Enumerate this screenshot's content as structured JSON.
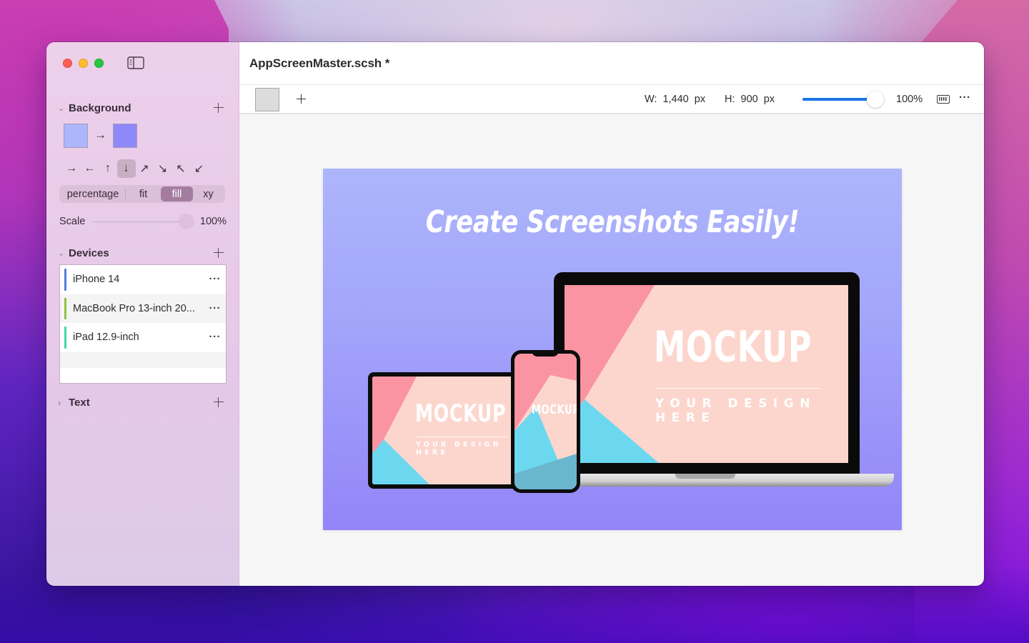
{
  "window": {
    "document_title": "AppScreenMaster.scsh *"
  },
  "sidebar": {
    "background_section": {
      "title": "Background",
      "gradient_from": "#aeb6fb",
      "gradient_to": "#8e88f8",
      "directions": [
        {
          "name": "right",
          "glyph": "→",
          "active": false
        },
        {
          "name": "left",
          "glyph": "←",
          "active": false
        },
        {
          "name": "up",
          "glyph": "↑",
          "active": false
        },
        {
          "name": "down",
          "glyph": "↓",
          "active": true
        },
        {
          "name": "up-right",
          "glyph": "↗",
          "active": false
        },
        {
          "name": "down-right",
          "glyph": "↘",
          "active": false
        },
        {
          "name": "up-left",
          "glyph": "↖",
          "active": false
        },
        {
          "name": "down-left",
          "glyph": "↙",
          "active": false
        }
      ],
      "modes": [
        {
          "label": "percentage",
          "active": false
        },
        {
          "label": "fit",
          "active": false
        },
        {
          "label": "fill",
          "active": true
        },
        {
          "label": "xy",
          "active": false
        }
      ],
      "scale_label": "Scale",
      "scale_value": "100%",
      "scale_fraction": 1.0
    },
    "devices_section": {
      "title": "Devices",
      "items": [
        {
          "name": "iPhone 14",
          "color": "#4f7fd8"
        },
        {
          "name": "MacBook Pro 13-inch 20...",
          "color": "#8cc43f"
        },
        {
          "name": "iPad 12.9-inch",
          "color": "#3fd6a6"
        }
      ]
    },
    "text_section": {
      "title": "Text"
    }
  },
  "toolbar": {
    "width_label": "W:",
    "width_value": "1,440",
    "height_label": "H:",
    "height_value": "900",
    "unit": "px",
    "zoom_value": "100%",
    "zoom_fraction": 1.0
  },
  "preview": {
    "headline": "Create Screenshots Easily!",
    "mockup_title": "MOCKUP",
    "mockup_subtitle": "YOUR DESIGN HERE",
    "colors": {
      "pink": "#fa94a2",
      "peach": "#fcd6cd",
      "cyan": "#6cd8ef"
    }
  }
}
